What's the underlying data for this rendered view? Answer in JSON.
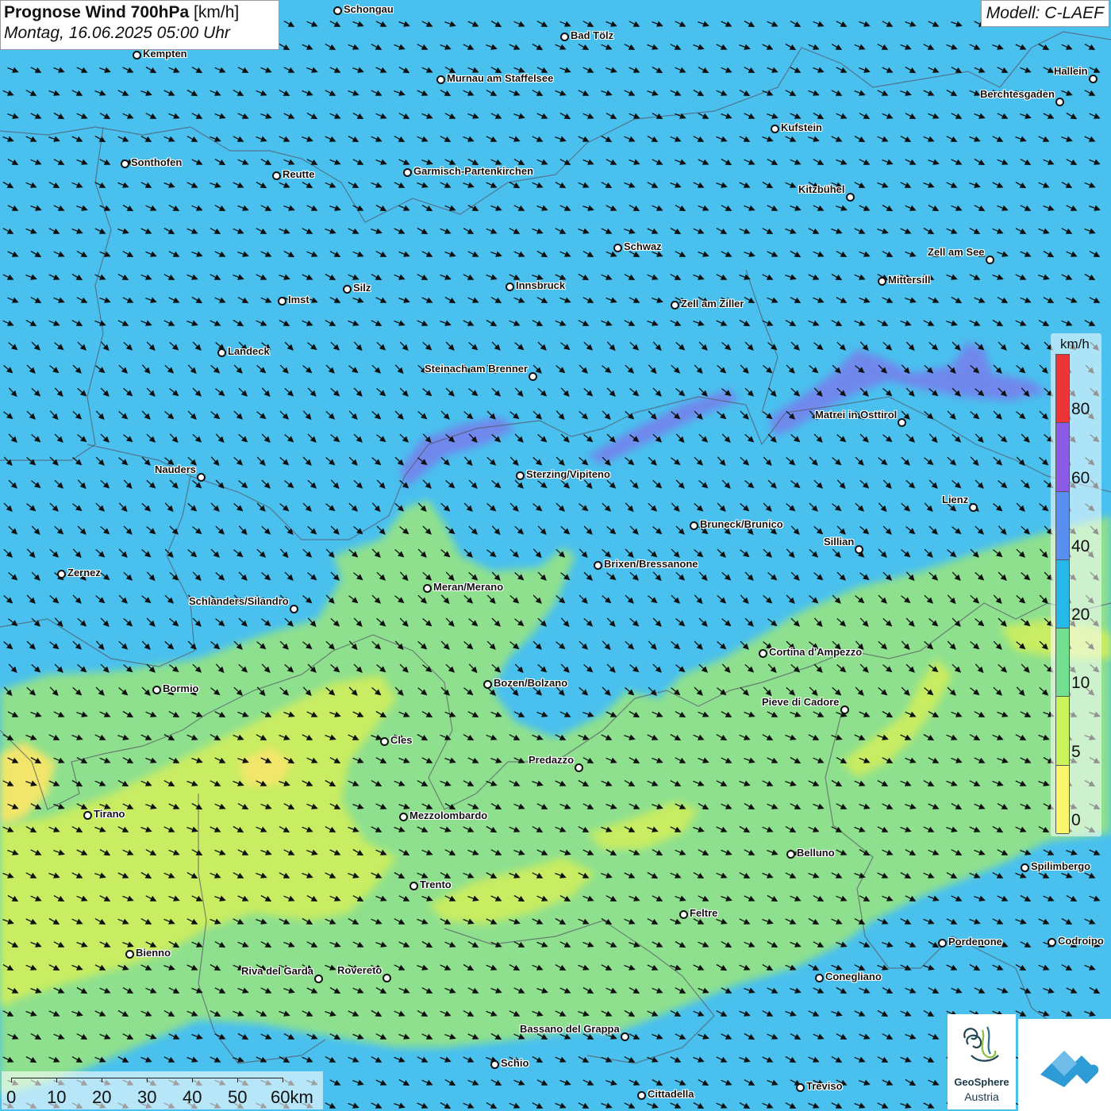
{
  "header": {
    "title_bold": "Prognose Wind 700hPa",
    "title_unit": "[km/h]",
    "date": "Montag, 16.06.2025 05:00 Uhr"
  },
  "model_label": "Modell: C-LAEF",
  "legend": {
    "unit": "km/h",
    "labels": [
      "80",
      "60",
      "40",
      "20",
      "10",
      "5",
      "0"
    ],
    "colors": [
      "#ee3434",
      "#8c5ae6",
      "#5a8ef0",
      "#27b8ea",
      "#72e090",
      "#cbf35b",
      "#fbf66e"
    ]
  },
  "scale_bar": {
    "labels": [
      "0",
      "10",
      "20",
      "30",
      "40",
      "50",
      "60km"
    ]
  },
  "wind_colors": {
    "calm_0_5": "#f2e66a",
    "light_5_10": "#c8ec62",
    "moderate_10_20": "#8ee08e",
    "fresh_20_40": "#49c0ee",
    "strong_40_60": "#5f97ec",
    "very_strong_60_80": "#8a63de"
  },
  "wind_direction": "northwest",
  "cities": [
    {
      "name": "Schongau"
    },
    {
      "name": "Bad Tölz"
    },
    {
      "name": "Kempten"
    },
    {
      "name": "Murnau am Staffelsee"
    },
    {
      "name": "Hallein"
    },
    {
      "name": "Berchtesgaden"
    },
    {
      "name": "Kufstein"
    },
    {
      "name": "Sonthofen"
    },
    {
      "name": "Reutte"
    },
    {
      "name": "Garmisch-Partenkirchen"
    },
    {
      "name": "Kitzbühel"
    },
    {
      "name": "Schwaz"
    },
    {
      "name": "Zell am See"
    },
    {
      "name": "Mittersill"
    },
    {
      "name": "Silz"
    },
    {
      "name": "Innsbruck"
    },
    {
      "name": "Imst"
    },
    {
      "name": "Zell am Ziller"
    },
    {
      "name": "Landeck"
    },
    {
      "name": "Steinach am Brenner"
    },
    {
      "name": "Matrei in Osttirol"
    },
    {
      "name": "Nauders"
    },
    {
      "name": "Sterzing/Vipiteno"
    },
    {
      "name": "Lienz"
    },
    {
      "name": "Bruneck/Brunico"
    },
    {
      "name": "Sillian"
    },
    {
      "name": "Zernez"
    },
    {
      "name": "Brixen/Bressanone"
    },
    {
      "name": "Meran/Merano"
    },
    {
      "name": "Schlanders/Silandro"
    },
    {
      "name": "Cortina d'Ampezzo"
    },
    {
      "name": "Bozen/Bolzano"
    },
    {
      "name": "Bormio"
    },
    {
      "name": "Pieve di Cadore"
    },
    {
      "name": "Cles"
    },
    {
      "name": "Predazzo"
    },
    {
      "name": "Tirano"
    },
    {
      "name": "Mezzolombardo"
    },
    {
      "name": "Belluno"
    },
    {
      "name": "Spilimbergo"
    },
    {
      "name": "Trento"
    },
    {
      "name": "Feltre"
    },
    {
      "name": "Pordenone"
    },
    {
      "name": "Codroipo"
    },
    {
      "name": "Bienno"
    },
    {
      "name": "Riva del Garda"
    },
    {
      "name": "Rovereto"
    },
    {
      "name": "Conegliano"
    },
    {
      "name": "Bassano del Grappa"
    },
    {
      "name": "Schio"
    },
    {
      "name": "Treviso"
    },
    {
      "name": "Cittadella"
    }
  ],
  "logos": {
    "geosphere_name": "GeoSphere",
    "geosphere_sub": "Austria"
  }
}
